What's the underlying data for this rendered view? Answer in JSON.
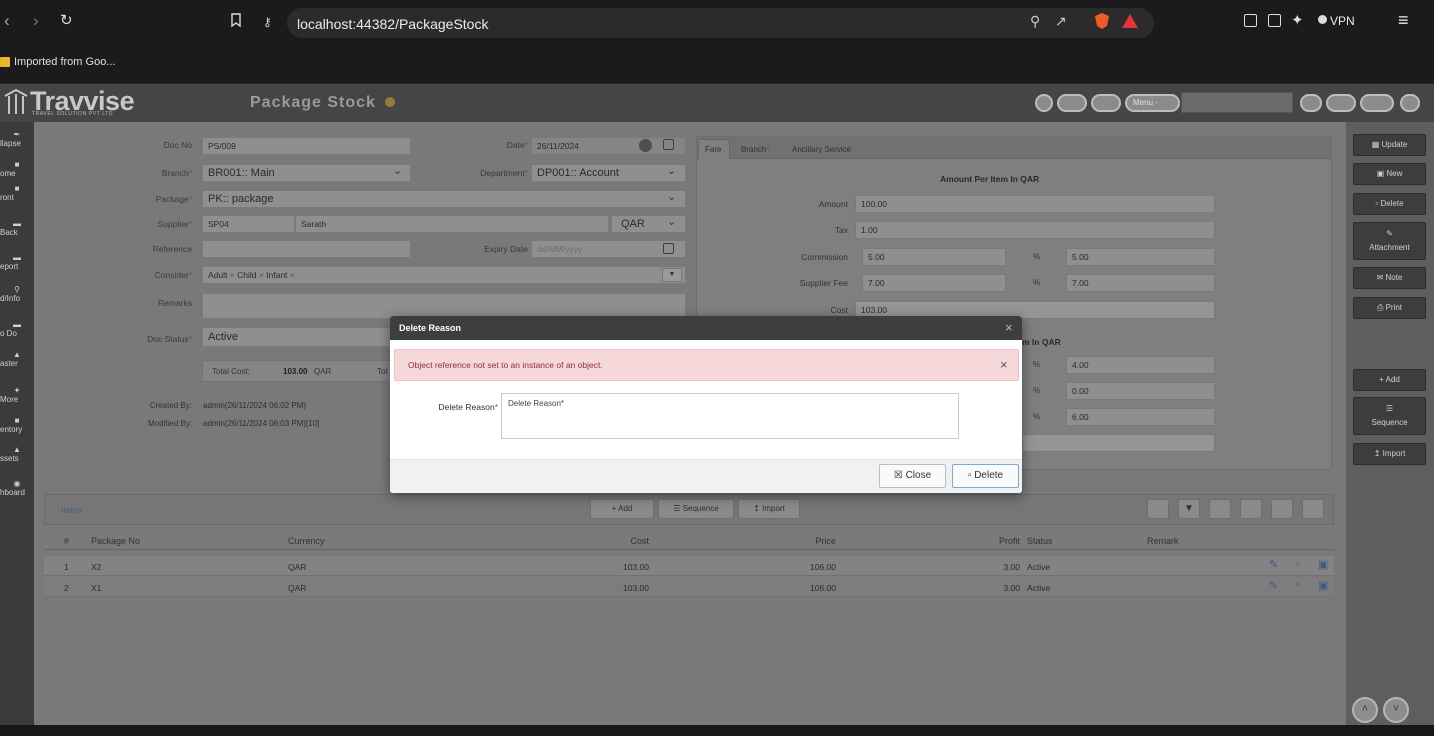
{
  "browser": {
    "url": "localhost:44382/PackageStock",
    "vpn_label": "VPN",
    "bookmark": "Imported from Goo..."
  },
  "app": {
    "logo": "Travvise",
    "logo_sub": "TRAVEL SOLUTION PVT LTD",
    "page_title": "Package Stock",
    "menu_label": "Menu -"
  },
  "sidebar": {
    "items": [
      "llapse",
      "ome",
      "ront",
      "Back",
      "eport",
      "d/Info",
      "o Do",
      "aster",
      "More",
      "entory",
      "ssets",
      "hboard"
    ]
  },
  "form": {
    "doc_no_label": "Doc No",
    "doc_no": "PS/009",
    "date_label": "Date",
    "date": "26/11/2024",
    "branch_label": "Branch",
    "branch": "BR001:: Main",
    "department_label": "Department",
    "department": "DP001:: Account",
    "package_label": "Package",
    "package": "PK:: package",
    "supplier_label": "Supplier",
    "supplier_code": "SP04",
    "supplier_name": "Sarath",
    "currency": "QAR",
    "reference_label": "Reference",
    "reference": "",
    "expiry_label": "Expiry Date",
    "expiry_placeholder": "dd/MM/yyyy",
    "consider_label": "Consider",
    "consider_tags": [
      "Adult",
      "Child",
      "Infant"
    ],
    "remarks_label": "Remarks",
    "doc_status_label": "Doc Status",
    "doc_status": "Active",
    "total_cost_label": "Total Cost:",
    "total_cost_value": "103.00",
    "total_cost_currency": "QAR",
    "total_trunc": "Tot",
    "created_by_label": "Created By:",
    "created_by": "admin(26/11/2024 06:02 PM)",
    "modified_by_label": "Modified By:",
    "modified_by": "admin(26/11/2024 06:03 PM)[10]",
    "required_mark": "*"
  },
  "fare": {
    "tabs": [
      "Fare",
      "Branch",
      "Ancillary Service"
    ],
    "heading": "Amount Per Item In QAR",
    "amount_label": "Amount",
    "amount": "100.00",
    "tax_label": "Tax",
    "tax": "1.00",
    "commission_label": "Commission",
    "commission": "5.00",
    "commission_pct": "5.00",
    "supplier_fee_label": "Supplier Fee",
    "supplier_fee": "7.00",
    "supplier_fee_pct": "7.00",
    "cost_label": "Cost",
    "cost": "103.00",
    "pct_symbol": "%",
    "heading2_partial": "m In QAR",
    "pct_values": [
      "4.00",
      "0.00",
      "6.00"
    ]
  },
  "right_panel": {
    "buttons": [
      "Update",
      "New",
      "Delete",
      "Attachment",
      "Note",
      "Print"
    ],
    "buttons2": [
      "Add",
      "Sequence",
      "Import"
    ]
  },
  "items": {
    "title": "Items",
    "add": "Add",
    "sequence": "Sequence",
    "import": "Import",
    "columns": [
      "#",
      "Package No",
      "Currency",
      "Cost",
      "Price",
      "Profit",
      "Status",
      "Remark"
    ],
    "rows": [
      {
        "n": "1",
        "pkg": "X2",
        "cur": "QAR",
        "cost": "103.00",
        "price": "106.00",
        "profit": "3.00",
        "status": "Active",
        "remark": ""
      },
      {
        "n": "2",
        "pkg": "X1",
        "cur": "QAR",
        "cost": "103.00",
        "price": "106.00",
        "profit": "3.00",
        "status": "Active",
        "remark": ""
      }
    ]
  },
  "modal": {
    "title": "Delete Reason",
    "error": "Object reference not set to an instance of an object.",
    "reason_label": "Delete Reason",
    "reason_value": "Delete Reason*",
    "close_btn": "Close",
    "delete_btn": "Delete"
  },
  "colors": {
    "brave_orange": "#f15a24",
    "brave_triangle": "#e23535",
    "alert_bg": "#f6d8da",
    "alert_text": "#8d2f3a",
    "delete_border": "#7aa7e0"
  }
}
